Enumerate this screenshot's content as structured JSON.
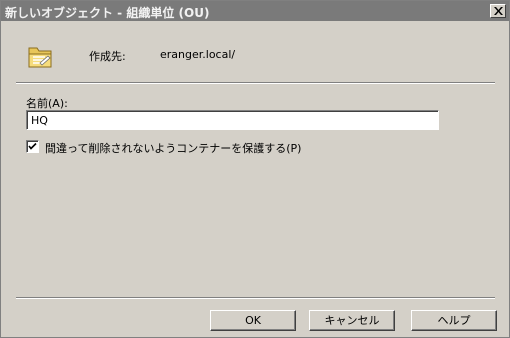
{
  "window": {
    "title": "新しいオブジェクト - 組織単位 (OU)"
  },
  "create_in": {
    "label": "作成先:",
    "value": "eranger.local/"
  },
  "name_field": {
    "label": "名前(A):",
    "value": "HQ"
  },
  "protect_checkbox": {
    "label": "間違って削除されないようコンテナーを保護する(P)",
    "checked": true
  },
  "buttons": {
    "ok": "OK",
    "cancel": "キャンセル",
    "help": "ヘルプ"
  },
  "icons": {
    "folder": "organizational-unit-folder-icon",
    "close": "close-icon",
    "check": "checkmark-icon"
  }
}
